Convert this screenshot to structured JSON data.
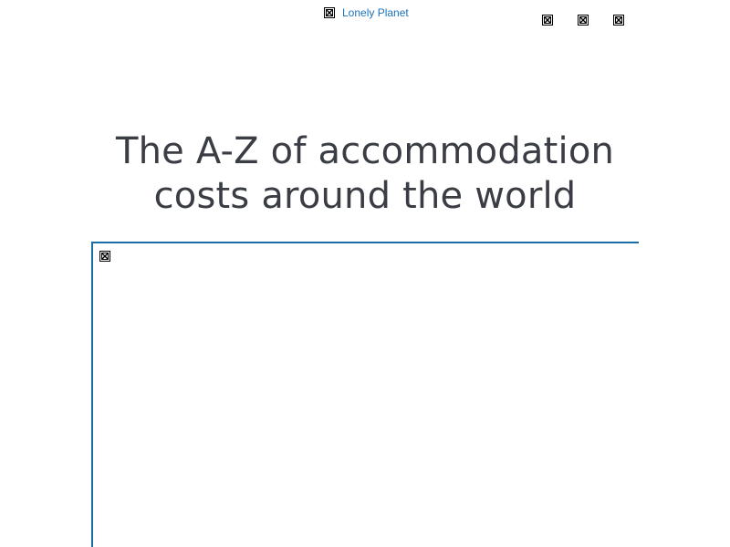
{
  "header": {
    "logo_alt": "Lonely Planet",
    "logo_icon": "broken-image-icon",
    "action_icons": [
      "broken-image-icon",
      "broken-image-icon",
      "broken-image-icon"
    ]
  },
  "article": {
    "title": "The A-Z of accommodation costs around the world",
    "title_line1": "The A-Z of accommodation",
    "title_line2": "costs around the world"
  },
  "embed": {
    "icon": "broken-image-icon"
  },
  "colors": {
    "link": "#1a73bd",
    "title": "#3a3d44",
    "frame_border": "#1a6ea8"
  }
}
